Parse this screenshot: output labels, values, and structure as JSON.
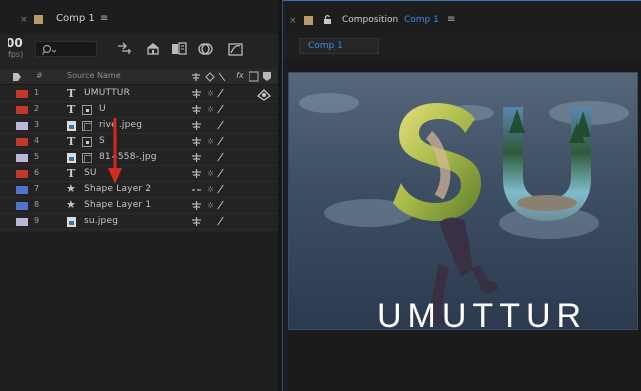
{
  "timeline_panel": {
    "tab_title": "Comp 1",
    "time_display": "00",
    "fps_display": "fps)"
  },
  "column_headers": {
    "number": "#",
    "source_name": "Source Name",
    "switches": "fx"
  },
  "layers": [
    {
      "num": "1",
      "name": "UMUTTUR",
      "type": "text",
      "label_color": "#c0392b"
    },
    {
      "num": "2",
      "name": "U",
      "type": "text",
      "label_color": "#c0392b"
    },
    {
      "num": "3",
      "name": "rive .jpeg",
      "type": "footage",
      "label_color": "#b8b8d6"
    },
    {
      "num": "4",
      "name": "S",
      "type": "text",
      "label_color": "#c0392b"
    },
    {
      "num": "5",
      "name": "81 4558-.jpg",
      "type": "footage",
      "label_color": "#b8b8d6"
    },
    {
      "num": "6",
      "name": "SU",
      "type": "text",
      "label_color": "#c0392b"
    },
    {
      "num": "7",
      "name": "Shape Layer 2",
      "type": "shape",
      "label_color": "#4f74c8"
    },
    {
      "num": "8",
      "name": "Shape Layer 1",
      "type": "shape",
      "label_color": "#4f74c8"
    },
    {
      "num": "9",
      "name": "su.jpeg",
      "type": "footage",
      "label_color": "#b8b8d6"
    }
  ],
  "composition_panel": {
    "tab_prefix": "Composition",
    "tab_comp_name": "Comp 1",
    "breadcrumb": "Comp 1"
  },
  "canvas_content": {
    "big_letters": "SU",
    "caption": "UMUTTUR"
  },
  "colors": {
    "accent_blue": "#3d8ae0",
    "arrow_red": "#d12a20"
  }
}
